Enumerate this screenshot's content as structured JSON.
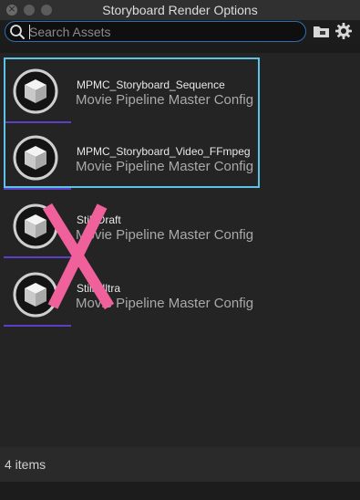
{
  "window": {
    "title": "Storyboard Render Options"
  },
  "search": {
    "placeholder": "Search Assets",
    "value": ""
  },
  "toolbar": {
    "folder_icon": "folder-icon",
    "settings_icon": "gear-icon"
  },
  "assets": [
    {
      "name": "MPMC_Storyboard_Sequence",
      "type": "Movie Pipeline Master Config",
      "selected": true,
      "marked_out": false
    },
    {
      "name": "MPMC_Storyboard_Video_FFmpeg",
      "type": "Movie Pipeline Master Config",
      "selected": true,
      "marked_out": false
    },
    {
      "name": "Still Draft",
      "type": "Movie Pipeline Master Config",
      "selected": false,
      "marked_out": true
    },
    {
      "name": "Still Ultra",
      "type": "Movie Pipeline Master Config",
      "selected": false,
      "marked_out": true
    }
  ],
  "status": {
    "count_text": "4 items"
  },
  "colors": {
    "selection_outline": "#5cc2e6",
    "asset_type_underline": "#5d3ec4",
    "strike_mark": "#f0609a",
    "search_border": "#2f6fb0"
  }
}
